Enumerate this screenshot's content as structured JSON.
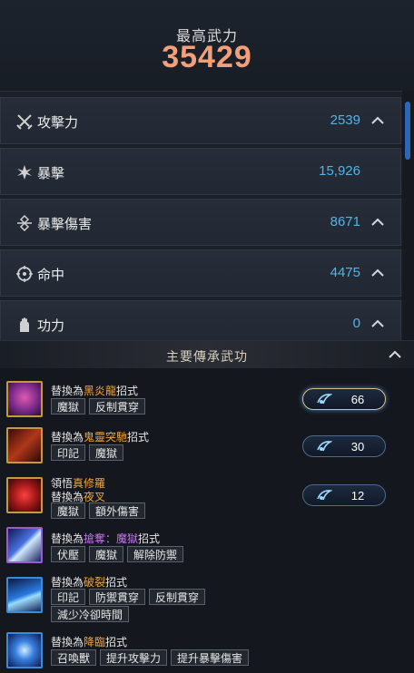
{
  "header": {
    "title": "最高武力",
    "value": "35429"
  },
  "stats": [
    {
      "icon": "crossed-swords-icon",
      "label": "攻擊力",
      "value": "2539"
    },
    {
      "icon": "burst-icon",
      "label": "暴擊",
      "value": "15,926"
    },
    {
      "icon": "critical-damage-icon",
      "label": "暴擊傷害",
      "value": "8671"
    },
    {
      "icon": "crosshair-icon",
      "label": "命中",
      "value": "4475"
    },
    {
      "icon": "power-hand-icon",
      "label": "功力",
      "value": "0"
    }
  ],
  "panel": {
    "title": "主要傳承武功"
  },
  "skills": [
    {
      "icon_color": "#7a2a8a",
      "line1": {
        "prefix": "替換為",
        "highlight": "黑炎龍",
        "suffix": "招式"
      },
      "tags": [
        "魔獄",
        "反制貫穿"
      ],
      "badge": "66"
    },
    {
      "icon_color": "#8a2a1a",
      "line1": {
        "prefix": "替換為",
        "highlight": "鬼靈突馳",
        "suffix": "招式"
      },
      "tags": [
        "印記",
        "魔獄"
      ],
      "badge": "30"
    },
    {
      "icon_color": "#a01818",
      "line1": {
        "prefix": "領悟",
        "highlight": "真修羅",
        "suffix": ""
      },
      "line2": {
        "prefix": "替換為",
        "highlight": "夜叉",
        "suffix": ""
      },
      "tags": [
        "魔獄",
        "額外傷害"
      ],
      "badge": "12"
    },
    {
      "icon_color": "#2a3aa0",
      "line1": {
        "prefix": "替換為",
        "highlight": "搶奪：魔獄",
        "suffix": "招式"
      },
      "tags": [
        "伏壓",
        "魔獄",
        "解除防禦"
      ]
    },
    {
      "icon_color": "#1f4fa0",
      "line1": {
        "prefix": "替換為",
        "highlight": "破裂",
        "suffix": "招式"
      },
      "tags": [
        "印記",
        "防禦貫穿",
        "反制貫穿"
      ],
      "tags2": [
        "減少冷卻時間"
      ]
    },
    {
      "icon_color": "#3050b0",
      "line1": {
        "prefix": "替換為",
        "highlight": "降臨",
        "suffix": "招式"
      },
      "tags": [
        "召喚獸",
        "提升攻擊力",
        "提升暴擊傷害"
      ]
    }
  ]
}
